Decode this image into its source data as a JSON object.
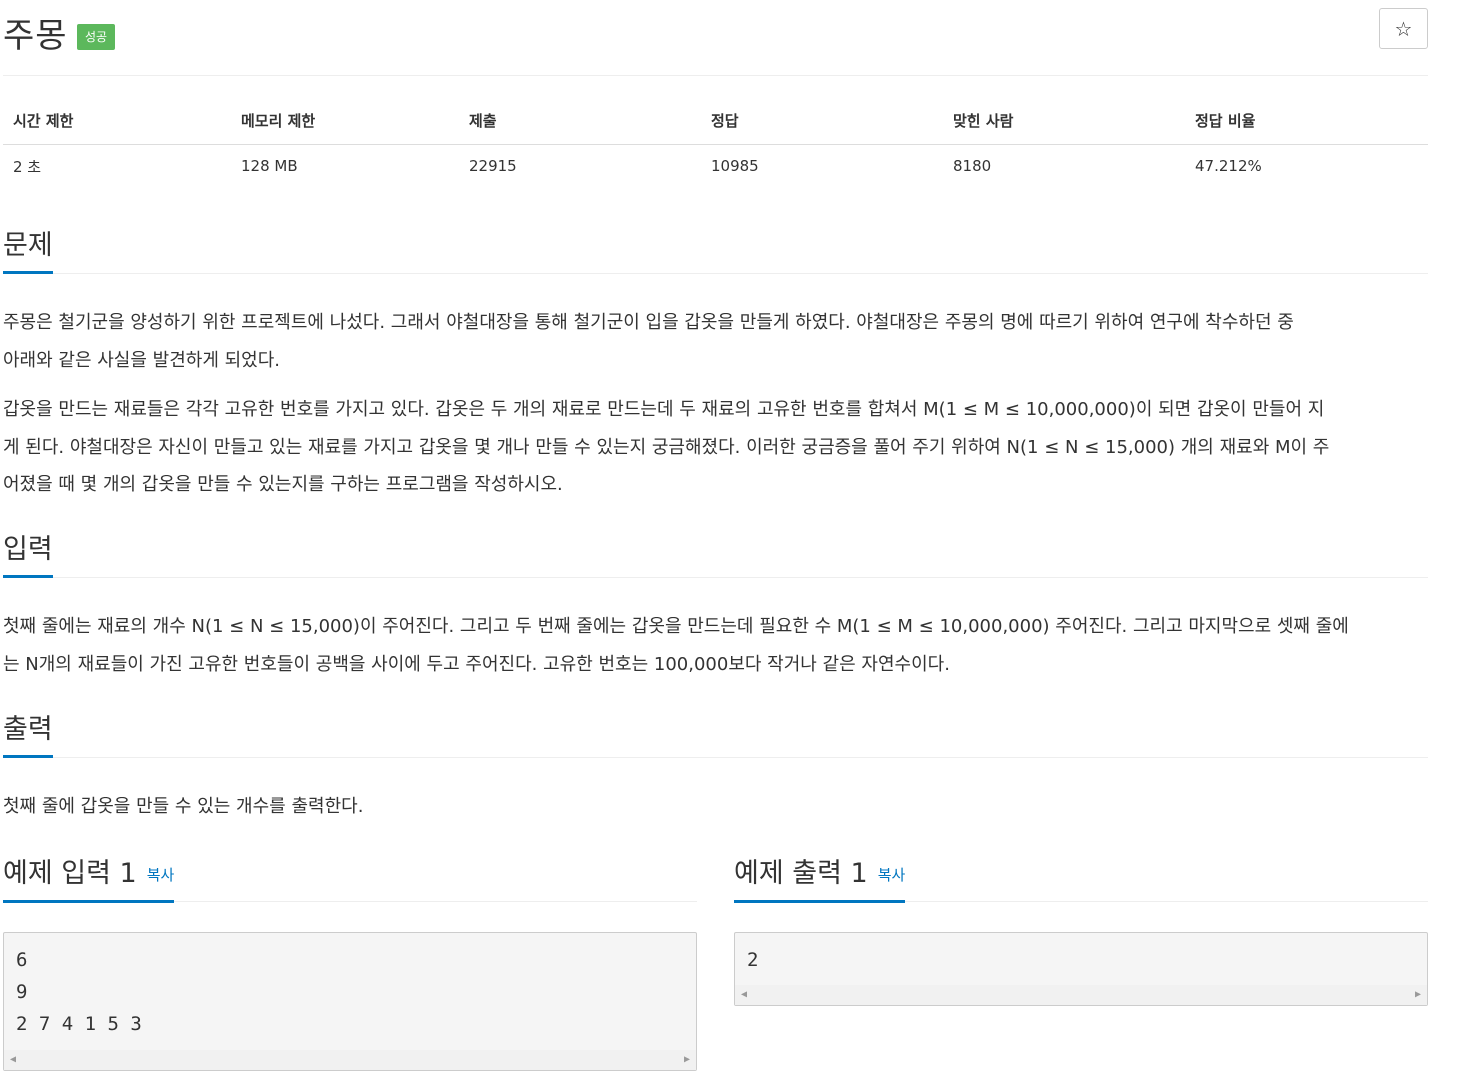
{
  "problem": {
    "title": "주몽",
    "badge": "성공",
    "star_icon": "☆"
  },
  "info": {
    "headers": [
      "시간 제한",
      "메모리 제한",
      "제출",
      "정답",
      "맞힌 사람",
      "정답 비율"
    ],
    "values": [
      "2 초",
      "128 MB",
      "22915",
      "10985",
      "8180",
      "47.212%"
    ]
  },
  "sections": {
    "problem": {
      "title": "문제",
      "lines_p1": [
        "주몽은 철기군을 양성하기 위한 프로젝트에 나섰다. 그래서 야철대장을 통해 철기군이 입을 갑옷을 만들게 하였다. 야철대장은 주몽의 명에 따르기 위하여 연구에 착수하던 중",
        "아래와 같은 사실을 발견하게 되었다."
      ],
      "lines_p2": [
        "갑옷을 만드는 재료들은 각각 고유한 번호를 가지고 있다. 갑옷은 두 개의 재료로 만드는데 두 재료의 고유한 번호를 합쳐서 M(1 ≤ M ≤ 10,000,000)이 되면 갑옷이 만들어 지",
        "게 된다. 야철대장은 자신이 만들고 있는 재료를 가지고 갑옷을 몇 개나 만들 수 있는지 궁금해졌다. 이러한 궁금증을 풀어 주기 위하여 N(1 ≤ N ≤ 15,000) 개의 재료와 M이 주",
        "어졌을 때 몇 개의 갑옷을 만들 수 있는지를 구하는 프로그램을 작성하시오."
      ]
    },
    "input": {
      "title": "입력",
      "lines": [
        "첫째 줄에는 재료의 개수 N(1 ≤ N ≤ 15,000)이 주어진다. 그리고 두 번째 줄에는 갑옷을 만드는데 필요한 수 M(1 ≤ M ≤ 10,000,000) 주어진다. 그리고 마지막으로 셋째 줄에",
        "는 N개의 재료들이 가진 고유한 번호들이 공백을 사이에 두고 주어진다. 고유한 번호는 100,000보다 작거나 같은 자연수이다."
      ]
    },
    "output": {
      "title": "출력",
      "lines": [
        "첫째 줄에 갑옷을 만들 수 있는 개수를 출력한다."
      ]
    }
  },
  "samples": {
    "copy_label": "복사",
    "input": {
      "title": "예제 입력 1",
      "lines": [
        "6",
        "9",
        "2 7 4 1 5 3"
      ]
    },
    "output": {
      "title": "예제 출력 1",
      "lines": [
        "2"
      ]
    }
  },
  "colors": {
    "accent": "#0076c0",
    "success": "#5cb85c"
  }
}
